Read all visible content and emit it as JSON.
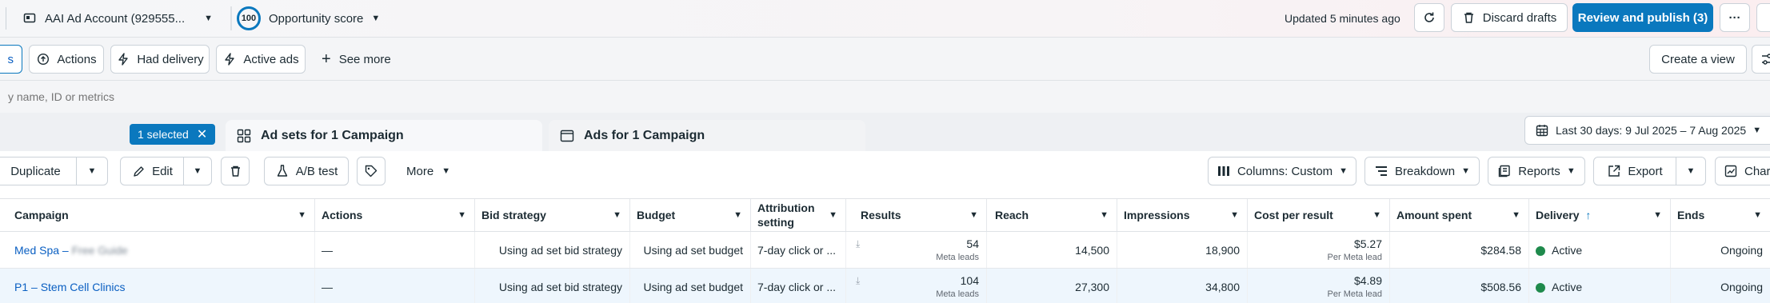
{
  "topbar": {
    "account_name": "AAI Ad Account (929555...",
    "score_badge": "100",
    "score_label": "Opportunity score",
    "updated": "Updated 5 minutes ago",
    "discard_label": "Discard drafts",
    "review_label": "Review and publish (3)",
    "more_label": "···"
  },
  "filters": {
    "partial_label": "s",
    "actions": "Actions",
    "had_delivery": "Had delivery",
    "active_ads": "Active ads",
    "see_more": "See more",
    "create_view": "Create a view"
  },
  "search": {
    "placeholder": "y name, ID or metrics"
  },
  "tabs": {
    "selected_chip": "1 selected",
    "adsets": "Ad sets for 1 Campaign",
    "ads": "Ads for 1 Campaign",
    "date_range": "Last 30 days: 9 Jul 2025 – 7 Aug 2025"
  },
  "toolbar": {
    "duplicate": "Duplicate",
    "edit": "Edit",
    "ab_test": "A/B test",
    "more": "More",
    "columns": "Columns: Custom",
    "breakdown": "Breakdown",
    "reports": "Reports",
    "export": "Export",
    "charts": "Charts"
  },
  "table": {
    "headers": {
      "campaign": "Campaign",
      "actions": "Actions",
      "bid_strategy": "Bid strategy",
      "budget": "Budget",
      "attribution_1": "Attribution",
      "attribution_2": "setting",
      "results": "Results",
      "reach": "Reach",
      "impressions": "Impressions",
      "cost_per_result": "Cost per result",
      "amount_spent": "Amount spent",
      "delivery": "Delivery",
      "delivery_sort": "↑",
      "ends": "Ends"
    },
    "rows": [
      {
        "campaign": "Med Spa – ",
        "campaign_blurred": "Free Guide",
        "actions": "—",
        "bid_strategy": "Using ad set bid strategy",
        "budget": "Using ad set budget",
        "attribution": "7-day click or ...",
        "results": "54",
        "results_sub": "Meta leads",
        "reach": "14,500",
        "impressions": "18,900",
        "cost_per_result": "$5.27",
        "cost_sub": "Per Meta lead",
        "amount_spent": "$284.58",
        "delivery": "Active",
        "ends": "Ongoing"
      },
      {
        "campaign": "P1 – Stem Cell Clinics",
        "campaign_blurred": "",
        "actions": "—",
        "bid_strategy": "Using ad set bid strategy",
        "budget": "Using ad set budget",
        "attribution": "7-day click or ...",
        "results": "104",
        "results_sub": "Meta leads",
        "reach": "27,300",
        "impressions": "34,800",
        "cost_per_result": "$4.89",
        "cost_sub": "Per Meta lead",
        "amount_spent": "$508.56",
        "delivery": "Active",
        "ends": "Ongoing"
      }
    ]
  },
  "colors": {
    "accent": "#0a78be",
    "active": "#1f8a4c",
    "link": "#0a5fc2"
  }
}
